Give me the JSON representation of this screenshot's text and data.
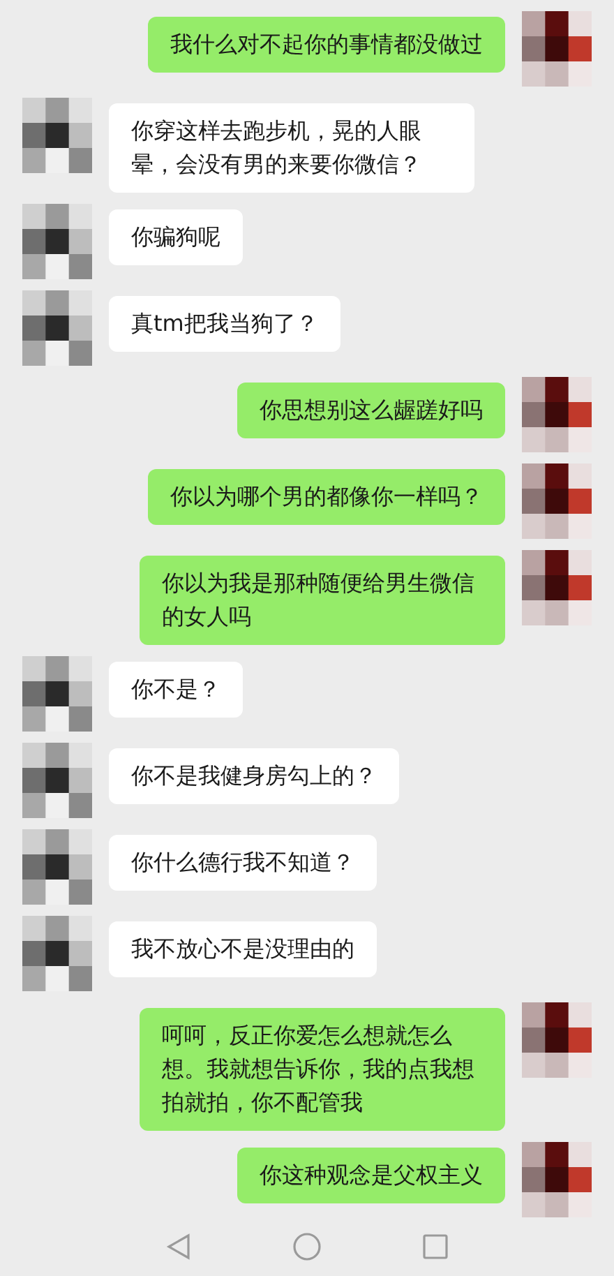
{
  "messages": [
    {
      "kind": "sent",
      "text": "我什么对不起你的事情都没做过"
    },
    {
      "kind": "received",
      "text": "你穿这样去跑步机，晃的人眼晕，会没有男的来要你微信？"
    },
    {
      "kind": "received",
      "text": "你骗狗呢"
    },
    {
      "kind": "received",
      "text": "真tm把我当狗了？"
    },
    {
      "kind": "sent",
      "text": "你思想别这么龌蹉好吗"
    },
    {
      "kind": "sent",
      "text": "你以为哪个男的都像你一样吗？"
    },
    {
      "kind": "sent",
      "text": "你以为我是那种随便给男生微信的女人吗"
    },
    {
      "kind": "received",
      "text": "你不是？"
    },
    {
      "kind": "received",
      "text": "你不是我健身房勾上的？"
    },
    {
      "kind": "received",
      "text": "你什么德行我不知道？"
    },
    {
      "kind": "received",
      "text": "我不放心不是没理由的"
    },
    {
      "kind": "sent",
      "text": "呵呵，反正你爱怎么想就怎么想。我就想告诉你，我的点我想拍就拍，你不配管我"
    },
    {
      "kind": "sent",
      "text": "你这种观念是父权主义"
    }
  ]
}
